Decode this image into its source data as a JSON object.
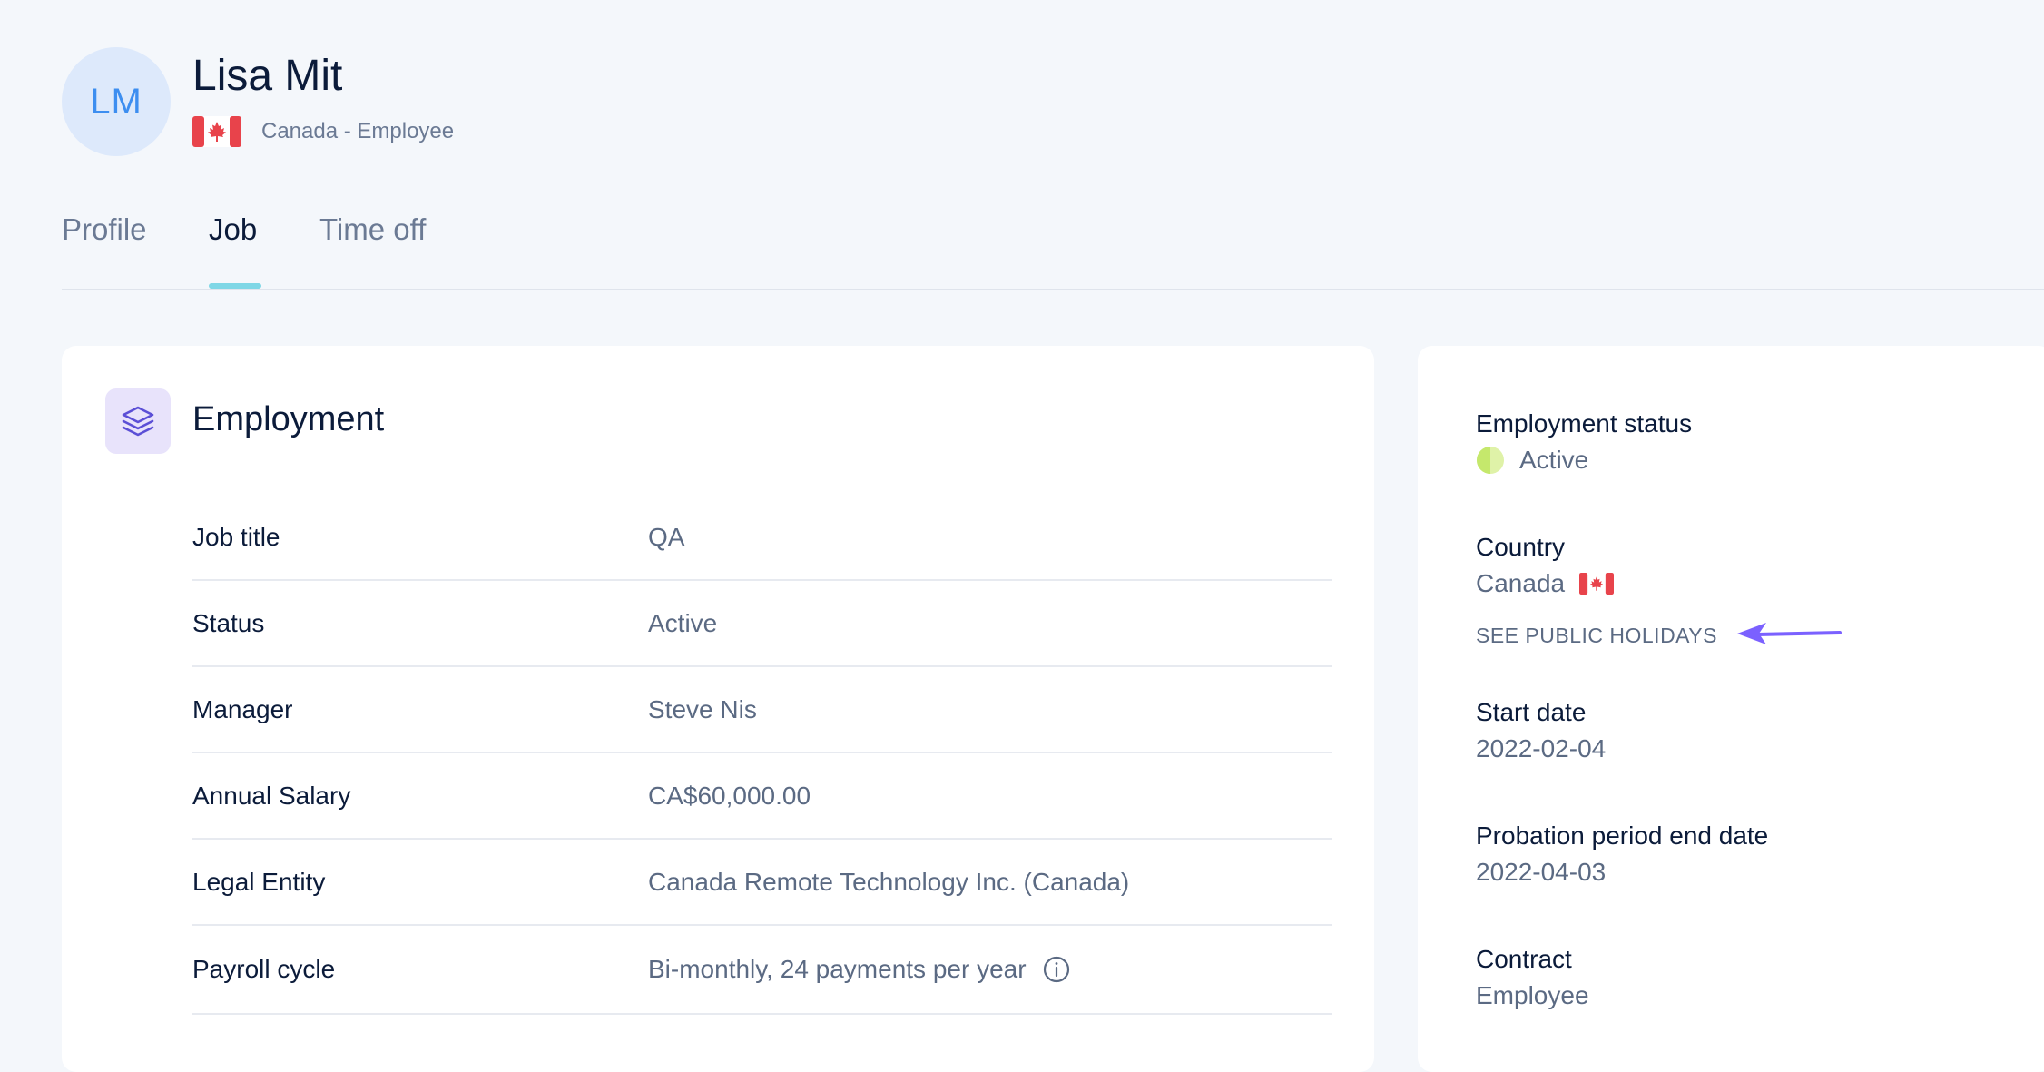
{
  "profile": {
    "initials": "LM",
    "name": "Lisa Mit",
    "subtitle": "Canada - Employee",
    "flag_icon": "canada-flag-icon"
  },
  "tabs": [
    {
      "label": "Profile",
      "active": false
    },
    {
      "label": "Job",
      "active": true
    },
    {
      "label": "Time off",
      "active": false
    }
  ],
  "employment": {
    "title": "Employment",
    "icon": "layers-icon",
    "rows": [
      {
        "label": "Job title",
        "value": "QA"
      },
      {
        "label": "Status",
        "value": "Active"
      },
      {
        "label": "Manager",
        "value": "Steve Nis"
      },
      {
        "label": "Annual Salary",
        "value": "CA$60,000.00"
      },
      {
        "label": "Legal Entity",
        "value": "Canada Remote Technology Inc. (Canada)"
      },
      {
        "label": "Payroll cycle",
        "value": "Bi-monthly, 24 payments per year",
        "icon": "info-icon"
      }
    ]
  },
  "sidebar": {
    "employment_status": {
      "label": "Employment status",
      "value": "Active"
    },
    "country": {
      "label": "Country",
      "value": "Canada",
      "link": "SEE PUBLIC HOLIDAYS"
    },
    "start_date": {
      "label": "Start date",
      "value": "2022-02-04"
    },
    "probation": {
      "label": "Probation period end date",
      "value": "2022-04-03"
    },
    "contract": {
      "label": "Contract",
      "value": "Employee"
    }
  },
  "colors": {
    "accent_tab": "#7fd7e6",
    "avatar_bg": "#dde9fb",
    "avatar_text": "#3d8ef0",
    "arrow": "#7b61ff",
    "status_active": "#c5e86c"
  }
}
